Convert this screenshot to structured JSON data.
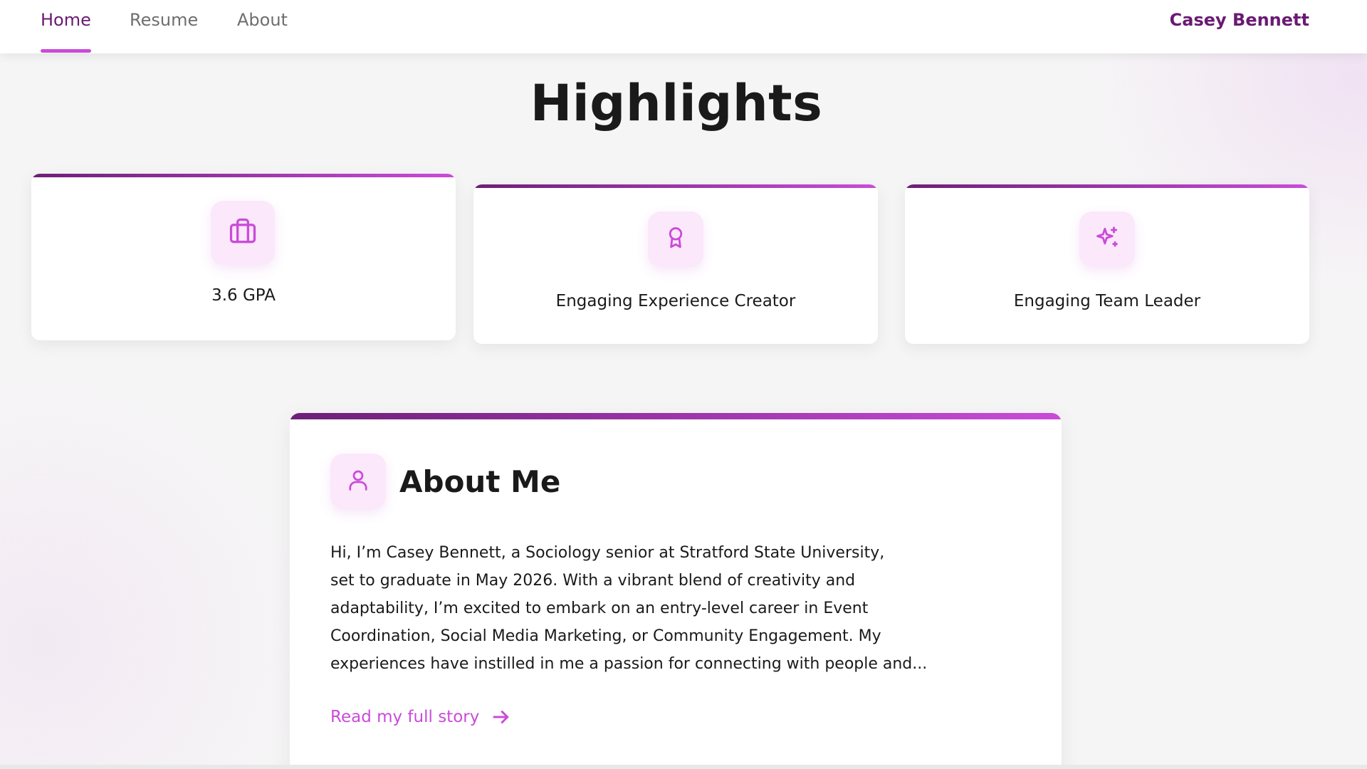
{
  "nav": {
    "tabs": [
      {
        "label": "Home",
        "active": true
      },
      {
        "label": "Resume",
        "active": false
      },
      {
        "label": "About",
        "active": false
      }
    ],
    "brand": "Casey Bennett"
  },
  "highlights": {
    "title": "Highlights",
    "cards": [
      {
        "label": "3.6 GPA",
        "icon": "briefcase-icon"
      },
      {
        "label": "Engaging Experience Creator",
        "icon": "award-ribbon-icon"
      },
      {
        "label": "Engaging Team Leader",
        "icon": "sparkles-icon"
      }
    ]
  },
  "about": {
    "title": "About Me",
    "icon": "user-icon",
    "lines": [
      "Hi, I’m Casey Bennett, a Sociology senior at Stratford State University,",
      "set to graduate in May 2026. With a vibrant blend of creativity and",
      "adaptability, I’m excited to embark on an entry-level career in Event",
      "Coordination, Social Media Marketing, or Community Engagement. My",
      "experiences have instilled in me a passion for connecting with people and..."
    ],
    "link_label": "Read my full story",
    "link_icon": "arrow-right-icon"
  },
  "colors": {
    "accent": "#c94cd8",
    "accent_dark": "#6d1f78",
    "icon_bg": "#fbe8fb",
    "text": "#1a1a1a",
    "nav_inactive": "#6e6e6e"
  }
}
